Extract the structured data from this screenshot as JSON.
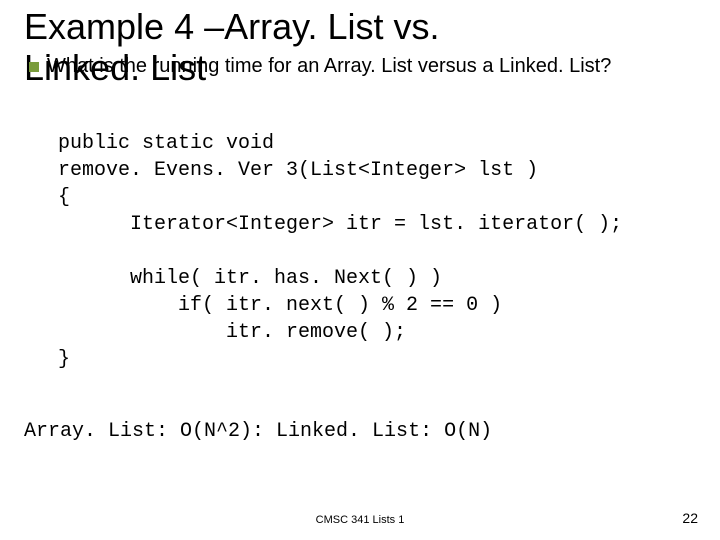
{
  "title": {
    "line1": "Example 4 –Array. List vs.",
    "line2": "Linked. List"
  },
  "bullet": {
    "text": "What is the running time for an Array. List versus a Linked. List?"
  },
  "code": {
    "l1": "public static void",
    "l2": "remove. Evens. Ver 3(List<Integer> lst )",
    "l3": "{",
    "l4": "      Iterator<Integer> itr = lst. iterator( );",
    "l5": "",
    "l6": "      while( itr. has. Next( ) )",
    "l7": "          if( itr. next( ) % 2 == 0 )",
    "l8": "              itr. remove( );",
    "l9": "}"
  },
  "answer": "Array. List: O(N^2): Linked. List: O(N)",
  "footer": {
    "center": "CMSC 341 Lists 1",
    "page": "22"
  }
}
